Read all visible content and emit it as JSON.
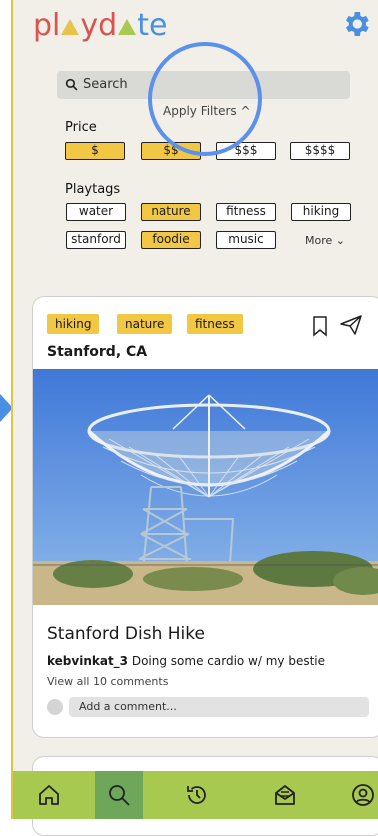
{
  "app": {
    "logo_text": [
      "pl",
      "yd",
      "te"
    ]
  },
  "search": {
    "placeholder": "Search"
  },
  "filters": {
    "apply_label": "Apply Filters ^",
    "price_label": "Price",
    "price_options": [
      "$",
      "$$",
      "$$$",
      "$$$$"
    ],
    "playtags_label": "Playtags",
    "playtags_row1": [
      "water",
      "nature",
      "fitness",
      "hiking"
    ],
    "playtags_row2": [
      "stanford",
      "foodie",
      "music"
    ],
    "more_label": "More ⌄"
  },
  "post": {
    "tags": [
      "hiking",
      "nature",
      "fitness"
    ],
    "location": "Stanford, CA",
    "title": "Stanford Dish Hike",
    "username": "kebvinkat_3",
    "caption": " Doing some cardio w/ my bestie",
    "comments_link": "View all 10 comments",
    "comment_placeholder": "Add a comment..."
  },
  "nav": {
    "items": [
      "home-icon",
      "search-icon",
      "history-icon",
      "inbox-icon",
      "profile-icon"
    ],
    "active": "search-icon"
  },
  "colors": {
    "accent_yellow": "#f2c744",
    "accent_green": "#a8c94f",
    "nav_active": "#6ea65a",
    "highlight_circle": "#5b91ea"
  }
}
